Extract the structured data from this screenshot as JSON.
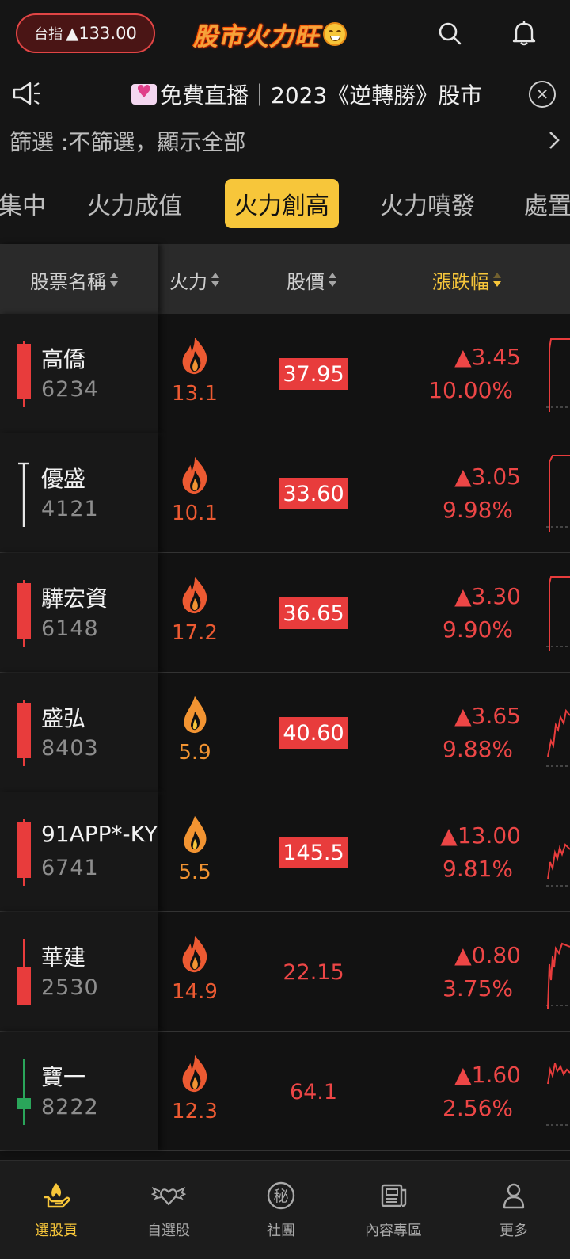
{
  "header": {
    "index_label": "台指",
    "index_value": "▲133.00",
    "brand_title": "股市火力旺"
  },
  "announcement": {
    "text": "免費直播｜2023《逆轉勝》股市"
  },
  "filter": {
    "text": "篩選 :不篩選，顯示全部"
  },
  "tabs": [
    {
      "label": "集中"
    },
    {
      "label": "火力成值"
    },
    {
      "label": "火力創高",
      "active": true
    },
    {
      "label": "火力噴發"
    },
    {
      "label": "處置"
    }
  ],
  "columns": {
    "name": "股票名稱",
    "fire": "火力",
    "price": "股價",
    "change": "漲跌幅"
  },
  "rows": [
    {
      "name": "高僑",
      "code": "6234",
      "fire": "13.1",
      "price": "37.95",
      "change": "▲3.45",
      "pct": "10.00%",
      "price_box": true,
      "candle": "red-full"
    },
    {
      "name": "優盛",
      "code": "4121",
      "fire": "10.1",
      "price": "33.60",
      "change": "▲3.05",
      "pct": "9.98%",
      "price_box": true,
      "candle": "doji"
    },
    {
      "name": "驊宏資",
      "code": "6148",
      "fire": "17.2",
      "price": "36.65",
      "change": "▲3.30",
      "pct": "9.90%",
      "price_box": true,
      "candle": "red-full"
    },
    {
      "name": "盛弘",
      "code": "8403",
      "fire": "5.9",
      "price": "40.60",
      "change": "▲3.65",
      "pct": "9.88%",
      "price_box": true,
      "candle": "red-full"
    },
    {
      "name": "91APP*-KY",
      "code": "6741",
      "fire": "5.5",
      "price": "145.5",
      "change": "▲13.00",
      "pct": "9.81%",
      "price_box": true,
      "candle": "red-full"
    },
    {
      "name": "華建",
      "code": "2530",
      "fire": "14.9",
      "price": "22.15",
      "change": "▲0.80",
      "pct": "3.75%",
      "price_box": false,
      "candle": "red-lower"
    },
    {
      "name": "寶一",
      "code": "8222",
      "fire": "12.3",
      "price": "64.1",
      "change": "▲1.60",
      "pct": "2.56%",
      "price_box": false,
      "candle": "green"
    }
  ],
  "bottom_nav": [
    {
      "label": "選股頁",
      "icon": "fire-hand-icon",
      "active": true
    },
    {
      "label": "自選股",
      "icon": "winged-heart-icon"
    },
    {
      "label": "社團",
      "icon": "secret-badge-icon",
      "glyph": "秘"
    },
    {
      "label": "內容專區",
      "icon": "newspaper-icon"
    },
    {
      "label": "更多",
      "icon": "person-icon"
    }
  ],
  "colors": {
    "accent": "#f7c63a",
    "up_red": "#e83c3c",
    "fire_red": "#ec5a32",
    "fire_orange": "#f29432",
    "down_green": "#2aa55a"
  }
}
